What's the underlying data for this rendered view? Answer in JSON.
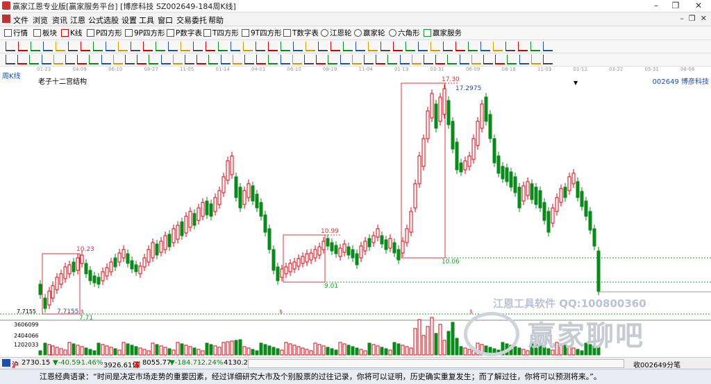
{
  "window": {
    "title": "赢家江恩专业版[赢家服务平台] [博彦科技 SZ002649-184周K线]",
    "menu": [
      "文件",
      "浏览",
      "资讯",
      "江恩",
      "公式选股",
      "设置",
      "工具",
      "窗口",
      "交易委托",
      "帮助"
    ]
  },
  "toolbar_main": [
    "行情",
    "板块",
    "K线",
    "P四方形",
    "9P四方形",
    "P数字表",
    "T四方形",
    "9T四方形",
    "T数字表",
    "江恩轮",
    "赢家轮",
    "六角形",
    "赢家服务"
  ],
  "chart": {
    "period_label": "周K线",
    "indicator_name": "老子十二宫结构",
    "stock_label": "002649 博彦科技",
    "dates": [
      "01-23",
      "04-09",
      "06-10",
      "08-27",
      "11-05",
      "01-14",
      "04-01",
      "06-10",
      "08-19",
      "11-04",
      "01-13",
      "03-31",
      "06-09",
      "08-18",
      "11-03",
      "01-12",
      "03-22",
      "05-31",
      "08-08"
    ],
    "annotations": {
      "high_label": "17.30",
      "high_alt": "17.2975",
      "level_10_06": "10.06",
      "box2_top": "10.99",
      "level_9_01": "9.01",
      "box1_top": "10.23",
      "low_label": "7.7155",
      "low_label_b": "7.71",
      "left_axis_low": "7.7155",
      "dollar_mark": "$"
    },
    "volume_axis": [
      "3606099",
      "2404066",
      "1202033"
    ]
  },
  "status": {
    "sh_index": "2730.15",
    "sh_change": "▼-40.59",
    "sh_pct": "-1.46%",
    "sh_amount": "3926.61亿",
    "sz_index": "8055.77",
    "sz_change": "▼-184.71",
    "sz_pct": "-2.24%",
    "sz_amount": "4130.26",
    "right": "收002649分笔"
  },
  "quote": "江恩经典语录：“时间是决定市场走势的重要因素，经过详细研究大市及个别股票的过往记录，你将可以证明，历史确实重复发生；而了解过往，你将可以预测将来。”。",
  "watermark": {
    "line1": "江恩工具软件 QQ:100800360",
    "line2": "赢家聊吧"
  },
  "colors": {
    "up": "#e0000c",
    "down": "#0a8a1a",
    "level": "#1a9e2a",
    "box": "#d9343b",
    "accent": "#1b4fa8"
  }
}
